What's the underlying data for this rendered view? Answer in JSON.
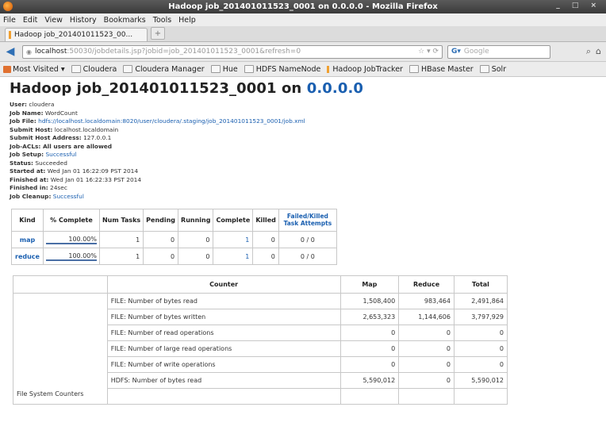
{
  "window": {
    "title": "Hadoop job_201401011523_0001 on 0.0.0.0 - Mozilla Firefox",
    "controls": "_ □ ×"
  },
  "menu": [
    "File",
    "Edit",
    "View",
    "History",
    "Bookmarks",
    "Tools",
    "Help"
  ],
  "tab": {
    "label": "Hadoop job_201401011523_00...",
    "new_tab": "+"
  },
  "urlbar": {
    "host": "localhost",
    "rest": ":50030/jobdetails.jsp?jobid=job_201401011523_0001&refresh=0",
    "search_placeholder": "Google"
  },
  "bookmarks": {
    "most_visited": "Most Visited",
    "items": [
      "Cloudera",
      "Cloudera Manager",
      "Hue",
      "HDFS NameNode",
      "Hadoop JobTracker",
      "HBase Master",
      "Solr"
    ]
  },
  "page": {
    "title_prefix": "Hadoop job_201401011523_0001 on ",
    "title_host": "0.0.0.0",
    "info": [
      {
        "label": "User:",
        "value": "cloudera",
        "link": false
      },
      {
        "label": "Job Name:",
        "value": "WordCount",
        "link": false
      },
      {
        "label": "Job File:",
        "value": "hdfs://localhost.localdomain:8020/user/cloudera/.staging/job_201401011523_0001/job.xml",
        "link": true
      },
      {
        "label": "Submit Host:",
        "value": "localhost.localdomain",
        "link": false
      },
      {
        "label": "Submit Host Address:",
        "value": "127.0.0.1",
        "link": false
      },
      {
        "label": "Job-ACLs: All users are allowed",
        "value": "",
        "link": false
      },
      {
        "label": "Job Setup:",
        "value": "Successful",
        "link": true
      },
      {
        "label": "Status:",
        "value": "Succeeded",
        "link": false
      },
      {
        "label": "Started at:",
        "value": "Wed Jan 01 16:22:09 PST 2014",
        "link": false
      },
      {
        "label": "Finished at:",
        "value": "Wed Jan 01 16:22:33 PST 2014",
        "link": false
      },
      {
        "label": "Finished in:",
        "value": "24sec",
        "link": false
      },
      {
        "label": "Job Cleanup:",
        "value": "Successful",
        "link": true
      }
    ]
  },
  "task_table": {
    "headers": [
      "Kind",
      "% Complete",
      "Num Tasks",
      "Pending",
      "Running",
      "Complete",
      "Killed",
      "Failed/Killed Task Attempts"
    ],
    "rows": [
      {
        "kind": "map",
        "pct": "100.00%",
        "num": "1",
        "pending": "0",
        "running": "0",
        "complete": "1",
        "killed": "0",
        "failed": "0 / 0"
      },
      {
        "kind": "reduce",
        "pct": "100.00%",
        "num": "1",
        "pending": "0",
        "running": "0",
        "complete": "1",
        "killed": "0",
        "failed": "0 / 0"
      }
    ]
  },
  "counter_table": {
    "headers": [
      "",
      "Counter",
      "Map",
      "Reduce",
      "Total"
    ],
    "group": "File System Counters",
    "rows": [
      {
        "counter": "FILE: Number of bytes read",
        "map": "1,508,400",
        "reduce": "983,464",
        "total": "2,491,864"
      },
      {
        "counter": "FILE: Number of bytes written",
        "map": "2,653,323",
        "reduce": "1,144,606",
        "total": "3,797,929"
      },
      {
        "counter": "FILE: Number of read operations",
        "map": "0",
        "reduce": "0",
        "total": "0"
      },
      {
        "counter": "FILE: Number of large read operations",
        "map": "0",
        "reduce": "0",
        "total": "0"
      },
      {
        "counter": "FILE: Number of write operations",
        "map": "0",
        "reduce": "0",
        "total": "0"
      },
      {
        "counter": "HDFS: Number of bytes read",
        "map": "5,590,012",
        "reduce": "0",
        "total": "5,590,012"
      }
    ]
  }
}
